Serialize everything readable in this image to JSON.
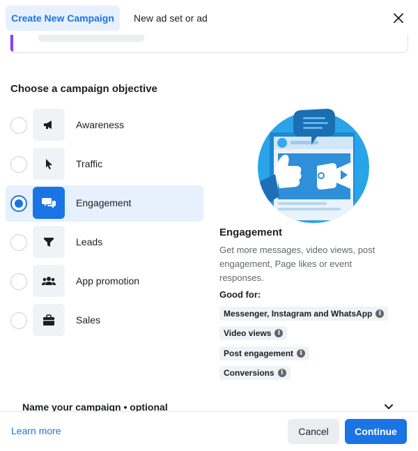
{
  "header": {
    "tab_active": "Create New Campaign",
    "tab_inactive": "New ad set or ad",
    "close_icon": "close-icon"
  },
  "section_title": "Choose a campaign objective",
  "objectives": [
    {
      "label": "Awareness",
      "icon": "megaphone-icon",
      "selected": false
    },
    {
      "label": "Traffic",
      "icon": "cursor-icon",
      "selected": false
    },
    {
      "label": "Engagement",
      "icon": "chat-bubbles-icon",
      "selected": true
    },
    {
      "label": "Leads",
      "icon": "funnel-icon",
      "selected": false
    },
    {
      "label": "App promotion",
      "icon": "people-icon",
      "selected": false
    },
    {
      "label": "Sales",
      "icon": "shopping-bag-icon",
      "selected": false
    }
  ],
  "detail": {
    "title": "Engagement",
    "description": "Get more messages, video views, post engagement, Page likes or event responses.",
    "good_for_label": "Good for:",
    "good_for": [
      "Messenger, Instagram and WhatsApp",
      "Video views",
      "Post engagement",
      "Conversions"
    ]
  },
  "name_campaign": "Name your campaign • optional",
  "footer": {
    "learn_more": "Learn more",
    "cancel": "Cancel",
    "continue": "Continue"
  },
  "colors": {
    "accent": "#1b74e4",
    "selected_bg": "#e7f0fd",
    "side_accent": "#8a3ffc"
  }
}
